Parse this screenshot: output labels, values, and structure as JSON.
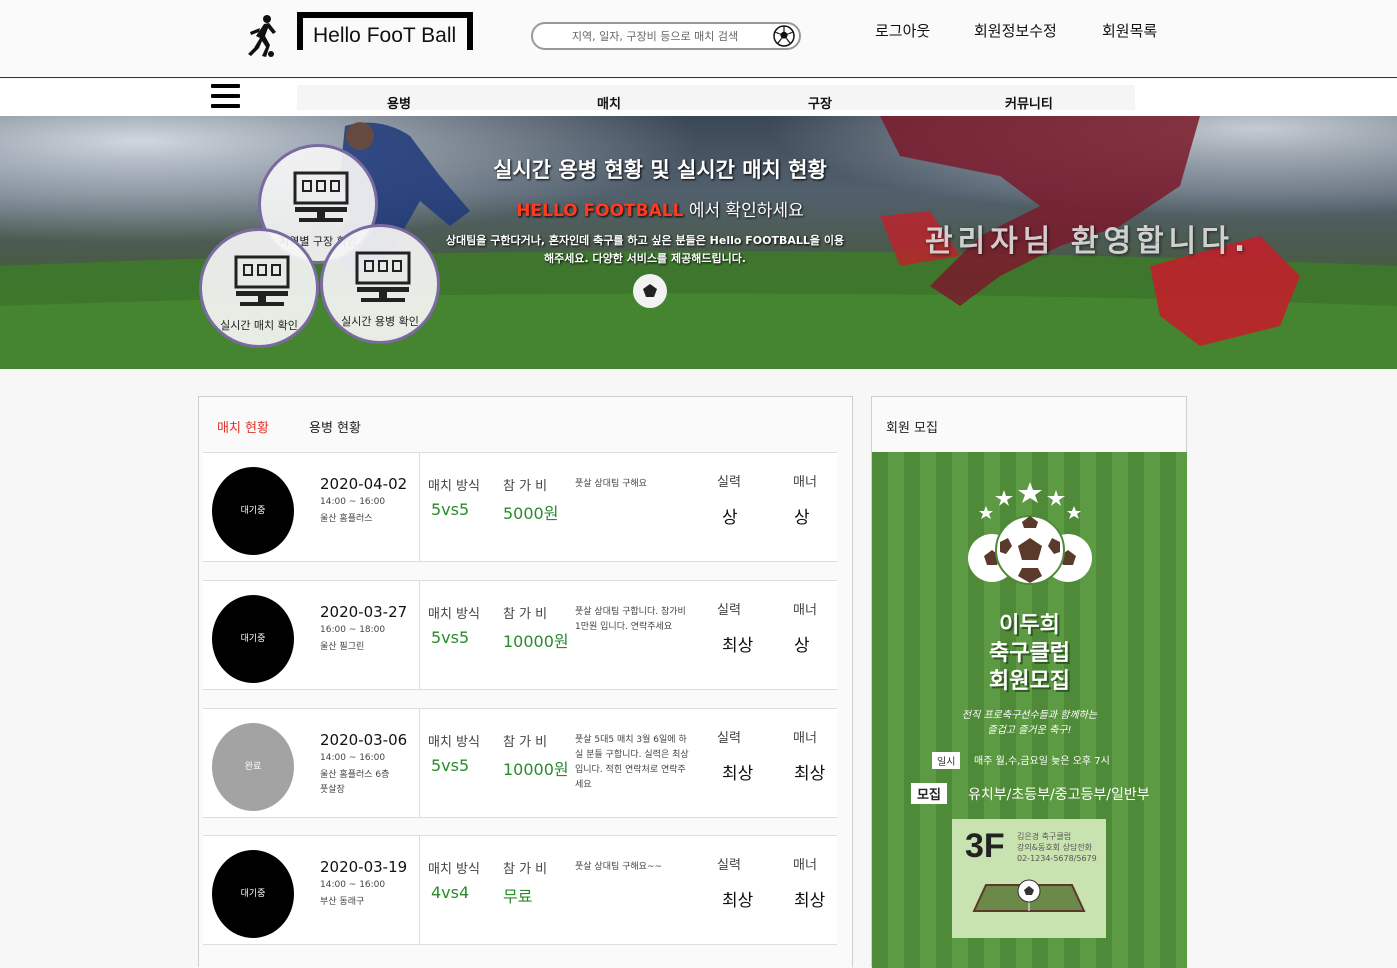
{
  "header": {
    "logo_text": "Hello FooT Ball",
    "search_placeholder": "지역, 일자, 구장비 등으로 매치 검색",
    "nav": [
      {
        "label": "로그아웃"
      },
      {
        "label": "회원정보수정"
      },
      {
        "label": "회원목록"
      }
    ]
  },
  "menu": {
    "items": [
      {
        "label": "용병"
      },
      {
        "label": "매치"
      },
      {
        "label": "구장"
      },
      {
        "label": "커뮤니티"
      }
    ]
  },
  "hero": {
    "title": "실시간 용병 현황 및 실시간 매치 현황",
    "brand": "HELLO FOOTBALL",
    "sub_suffix": " 에서 확인하세요",
    "desc_line1": "상대팀을 구한다거나, 혼자인데 축구를 하고 싶은 분들은 Hello FOOTBALL을 이용",
    "desc_line2": "해주세요. 다양한 서비스를 제공해드립니다.",
    "welcome": "관리자님 환영합니다.",
    "circles": [
      {
        "label": "지역별 구장 확인"
      },
      {
        "label": "실시간 매치 확인"
      },
      {
        "label": "실시간 용병 확인"
      }
    ]
  },
  "tabs": [
    {
      "label": "매치 현황",
      "active": true
    },
    {
      "label": "용병 현황",
      "active": false
    }
  ],
  "labels": {
    "match_type": "매치 방식",
    "fee": "참 가 비",
    "skill": "실력",
    "manner": "매너"
  },
  "matches": [
    {
      "status": "대기중",
      "done": false,
      "date": "2020-04-02",
      "time": "14:00 ~ 16:00",
      "place": "울산 홈플러스",
      "type": "5vs5",
      "fee": "5000원",
      "memo": "풋살 상대팀 구해요",
      "skill": "상",
      "manner": "상"
    },
    {
      "status": "대기중",
      "done": false,
      "date": "2020-03-27",
      "time": "16:00 ~ 18:00",
      "place": "울산 필그린",
      "type": "5vs5",
      "fee": "10000원",
      "memo": "풋살 상대팀 구합니다. 참가비 1만원 입니다. 연락주세요",
      "skill": "최상",
      "manner": "상"
    },
    {
      "status": "완료",
      "done": true,
      "date": "2020-03-06",
      "time": "14:00 ~ 16:00",
      "place": "울산 홈플러스 6층 풋살장",
      "type": "5vs5",
      "fee": "10000원",
      "memo": "풋살 5대5 매치 3월 6일에 하실 분들 구합니다. 실력은 최상입니다. 적힌 연락처로 연락주세요",
      "skill": "최상",
      "manner": "최상"
    },
    {
      "status": "대기중",
      "done": false,
      "date": "2020-03-19",
      "time": "14:00 ~ 16:00",
      "place": "부산 동래구",
      "type": "4vs4",
      "fee": "무료",
      "memo": "풋살 상대팀 구해요~~",
      "skill": "최상",
      "manner": "최상"
    }
  ],
  "sidebar": {
    "title": "회원 모집",
    "poster": {
      "club_line1": "이두희",
      "club_line2": "축구클럽",
      "club_line3": "회원모집",
      "slogan_line1": "전직 프로축구선수들과 함께하는",
      "slogan_line2": "즐겁고 즐거운 축구!",
      "schedule_tag": "일시",
      "schedule": "매주 월,수,금요일 늦은 오후 7시",
      "recruit_tag": "모집",
      "recruit": "유치부/초등부/중고등부/일반부",
      "floor": "3F",
      "contact_line1": "김은경 축구클럽",
      "contact_line2": "강의&동호회 상담전화",
      "contact_line3": "02-1234-5678/5679"
    }
  },
  "colors": {
    "accent_red": "#e0342a",
    "value_green": "#2a8a2a",
    "poster_green": "#4e8a37",
    "circle_border": "#7a6aa0"
  }
}
